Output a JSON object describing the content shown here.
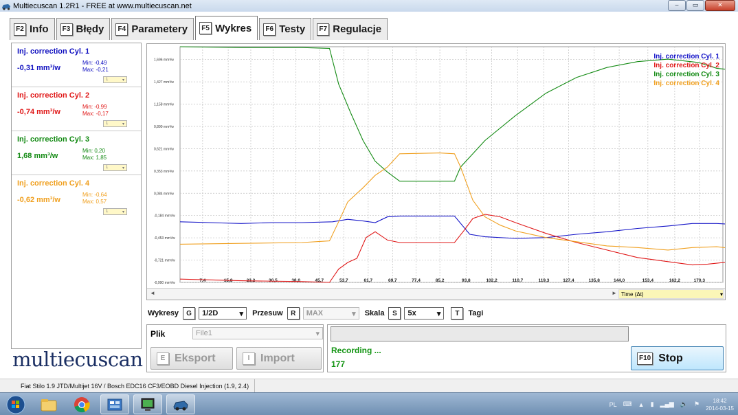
{
  "window": {
    "title": "Multiecuscan 1.2R1 - FREE at www.multiecuscan.net",
    "min": "‒",
    "max": "▭",
    "close": "✕"
  },
  "tabs": [
    {
      "key": "F2",
      "label": "Info"
    },
    {
      "key": "F3",
      "label": "Błędy"
    },
    {
      "key": "F4",
      "label": "Parametery"
    },
    {
      "key": "F5",
      "label": "Wykres"
    },
    {
      "key": "F6",
      "label": "Testy"
    },
    {
      "key": "F7",
      "label": "Regulacje"
    }
  ],
  "cylinders": [
    {
      "name": "Inj. correction Cyl. 1",
      "value": "-0,31 mm³/w",
      "min": "Min: -0,49",
      "max": "Max: -0,21",
      "color": "#1010c0",
      "sel": "1"
    },
    {
      "name": "Inj. correction Cyl. 2",
      "value": "-0,74 mm³/w",
      "min": "Min: -0,99",
      "max": "Max: -0,17",
      "color": "#e01818",
      "sel": "1"
    },
    {
      "name": "Inj. correction Cyl. 3",
      "value": "1,68 mm³/w",
      "min": "Min: 0,20",
      "max": "Max: 1,85",
      "color": "#138a13",
      "sel": "1"
    },
    {
      "name": "Inj. correction Cyl. 4",
      "value": "-0,62 mm³/w",
      "min": "Min: -0,64",
      "max": "Max: 0,57",
      "color": "#f0a020",
      "sel": "1"
    }
  ],
  "logo": "multiecuscan",
  "chart_data": {
    "type": "line",
    "y_ticks": [
      "1,696 mm³/w",
      "1,427 mm³/w",
      "1,158 mm³/w",
      "0,890 mm³/w",
      "0,621 mm³/w",
      "0,353 mm³/w",
      "0,084 mm³/w",
      "-0,184 mm³/w",
      "-0,453 mm³/w",
      "-0,721 mm³/w",
      "-0,990 mm³/w"
    ],
    "y_tick_values": [
      1.696,
      1.427,
      1.158,
      0.89,
      0.621,
      0.353,
      0.084,
      -0.184,
      -0.453,
      -0.721,
      -0.99
    ],
    "x_ticks": [
      "7,4",
      "15,8",
      "23,2",
      "30,5",
      "38,0",
      "45,7",
      "53,7",
      "61,7",
      "69,7",
      "77,4",
      "85,2",
      "93,8",
      "102,2",
      "110,7",
      "119,3",
      "127,4",
      "135,8",
      "144,0",
      "153,4",
      "162,2",
      "170,3"
    ],
    "x_tick_values": [
      7.4,
      15.8,
      23.2,
      30.5,
      38.0,
      45.7,
      53.7,
      61.7,
      69.7,
      77.4,
      85.2,
      93.8,
      102.2,
      110.7,
      119.3,
      127.4,
      135.8,
      144.0,
      153.4,
      162.2,
      170.3
    ],
    "ylim": [
      -0.99,
      1.85
    ],
    "xlim": [
      0,
      178
    ],
    "grid": true,
    "legend_position": "top-right",
    "series": [
      {
        "name": "Inj. correction Cyl. 1",
        "color": "#1515c8",
        "points": [
          [
            0,
            -0.26
          ],
          [
            10,
            -0.27
          ],
          [
            20,
            -0.28
          ],
          [
            30,
            -0.27
          ],
          [
            40,
            -0.27
          ],
          [
            50,
            -0.26
          ],
          [
            55,
            -0.23
          ],
          [
            60,
            -0.25
          ],
          [
            64,
            -0.27
          ],
          [
            68,
            -0.2
          ],
          [
            72,
            -0.19
          ],
          [
            85,
            -0.19
          ],
          [
            90,
            -0.19
          ],
          [
            95,
            -0.41
          ],
          [
            100,
            -0.44
          ],
          [
            110,
            -0.46
          ],
          [
            120,
            -0.45
          ],
          [
            130,
            -0.41
          ],
          [
            140,
            -0.38
          ],
          [
            150,
            -0.34
          ],
          [
            160,
            -0.31
          ],
          [
            168,
            -0.28
          ],
          [
            176,
            -0.28
          ],
          [
            181,
            -0.29
          ]
        ]
      },
      {
        "name": "Inj. correction Cyl. 2",
        "color": "#e01818",
        "points": [
          [
            0,
            -0.95
          ],
          [
            20,
            -0.97
          ],
          [
            40,
            -0.98
          ],
          [
            49,
            -0.99
          ],
          [
            52,
            -0.83
          ],
          [
            55,
            -0.75
          ],
          [
            58,
            -0.7
          ],
          [
            61,
            -0.45
          ],
          [
            64,
            -0.38
          ],
          [
            68,
            -0.48
          ],
          [
            72,
            -0.51
          ],
          [
            85,
            -0.51
          ],
          [
            90,
            -0.51
          ],
          [
            93,
            -0.37
          ],
          [
            96,
            -0.22
          ],
          [
            100,
            -0.17
          ],
          [
            105,
            -0.2
          ],
          [
            110,
            -0.27
          ],
          [
            120,
            -0.4
          ],
          [
            130,
            -0.51
          ],
          [
            140,
            -0.6
          ],
          [
            150,
            -0.69
          ],
          [
            160,
            -0.74
          ],
          [
            168,
            -0.78
          ],
          [
            173,
            -0.77
          ],
          [
            181,
            -0.74
          ]
        ]
      },
      {
        "name": "Inj. correction Cyl. 3",
        "color": "#138a13",
        "points": [
          [
            0,
            1.85
          ],
          [
            20,
            1.84
          ],
          [
            40,
            1.84
          ],
          [
            49,
            1.83
          ],
          [
            52,
            1.4
          ],
          [
            56,
            1.05
          ],
          [
            60,
            0.72
          ],
          [
            64,
            0.47
          ],
          [
            68,
            0.34
          ],
          [
            72,
            0.23
          ],
          [
            85,
            0.23
          ],
          [
            90,
            0.23
          ],
          [
            92,
            0.4
          ],
          [
            100,
            0.72
          ],
          [
            110,
            1.02
          ],
          [
            120,
            1.29
          ],
          [
            130,
            1.48
          ],
          [
            140,
            1.6
          ],
          [
            150,
            1.67
          ],
          [
            160,
            1.7
          ],
          [
            170,
            1.66
          ],
          [
            176,
            1.59
          ],
          [
            181,
            1.57
          ]
        ]
      },
      {
        "name": "Inj. correction Cyl. 4",
        "color": "#f0a020",
        "points": [
          [
            0,
            -0.53
          ],
          [
            20,
            -0.52
          ],
          [
            40,
            -0.51
          ],
          [
            49,
            -0.49
          ],
          [
            52,
            -0.26
          ],
          [
            55,
            -0.02
          ],
          [
            60,
            0.15
          ],
          [
            64,
            0.3
          ],
          [
            68,
            0.4
          ],
          [
            72,
            0.56
          ],
          [
            85,
            0.57
          ],
          [
            90,
            0.56
          ],
          [
            92,
            0.4
          ],
          [
            96,
            0.0
          ],
          [
            100,
            -0.2
          ],
          [
            105,
            -0.3
          ],
          [
            110,
            -0.37
          ],
          [
            120,
            -0.45
          ],
          [
            130,
            -0.5
          ],
          [
            140,
            -0.55
          ],
          [
            150,
            -0.57
          ],
          [
            160,
            -0.6
          ],
          [
            168,
            -0.57
          ],
          [
            176,
            -0.56
          ],
          [
            181,
            -0.58
          ]
        ]
      }
    ]
  },
  "chart_x_label": "Time (Δt)",
  "scroll_left": "◄",
  "scroll_right": "►",
  "controls": {
    "wykresy": "Wykresy",
    "wykresy_key": "G",
    "wykresy_val": "1/2D",
    "przesuw": "Przesuw",
    "przesuw_key": "R",
    "przesuw_val": "MAX",
    "skala": "Skala",
    "skala_key": "S",
    "skala_val": "5x",
    "tagi_key": "T",
    "tagi": "Tagi"
  },
  "file": {
    "label": "Plik",
    "value": "File1",
    "export_key": "E",
    "export": "Eksport",
    "import_key": "I",
    "import": "Import"
  },
  "recording": {
    "status": "Recording ...",
    "count": "177",
    "stop_key": "F10",
    "stop": "Stop"
  },
  "statusbar": {
    "vehicle": "Fiat Stilo 1.9 JTD/Multijet 16V / Bosch EDC16 CF3/EOBD Diesel Injection (1.9, 2.4)"
  },
  "tray": {
    "lang": "PL",
    "time": "18:42",
    "date": "2014-03-15"
  },
  "colors": {
    "accent": "#1b2f63",
    "cyl1": "#1010c0",
    "cyl2": "#e01818",
    "cyl3": "#138a13",
    "cyl4": "#f0a020"
  }
}
